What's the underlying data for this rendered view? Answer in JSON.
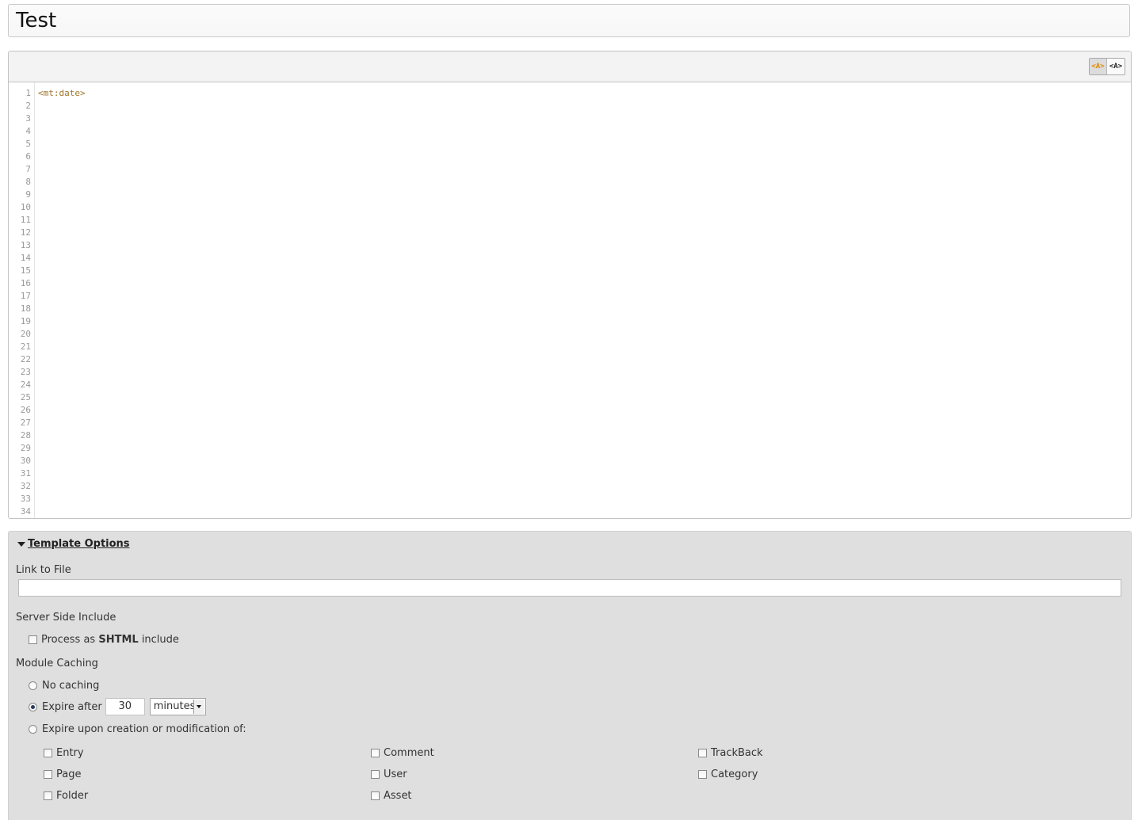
{
  "title": "Test",
  "editor": {
    "toolbar": {
      "highlight_on_label": "<A>",
      "highlight_off_label": "<A>"
    },
    "line_numbers": [
      "1",
      "2",
      "3",
      "4",
      "5",
      "6",
      "7",
      "8",
      "9",
      "10",
      "11",
      "12",
      "13",
      "14",
      "15",
      "16",
      "17",
      "18",
      "19",
      "20",
      "21",
      "22",
      "23",
      "24",
      "25",
      "26",
      "27",
      "28",
      "29",
      "30",
      "31",
      "32",
      "33",
      "34"
    ],
    "code_lines": [
      "<mt:date>"
    ],
    "tag_color": "#a0752a"
  },
  "options": {
    "toggle_label": "Template Options",
    "link_to_file_label": "Link to File",
    "link_to_file_value": "",
    "ssi_label": "Server Side Include",
    "ssi_checkbox_prefix": "Process as",
    "ssi_checkbox_strong": "SHTML",
    "ssi_checkbox_suffix": "include",
    "ssi_checked": false,
    "module_caching_label": "Module Caching",
    "no_caching_label": "No caching",
    "expire_after_label": "Expire after",
    "expire_after_value": "30",
    "expire_unit": "minutes",
    "expire_upon_label": "Expire upon creation or modification of:",
    "selected_caching": "expire_after",
    "object_types": [
      [
        "Entry",
        "Comment",
        "TrackBack"
      ],
      [
        "Page",
        "User",
        "Category"
      ],
      [
        "Folder",
        "Asset"
      ]
    ]
  }
}
